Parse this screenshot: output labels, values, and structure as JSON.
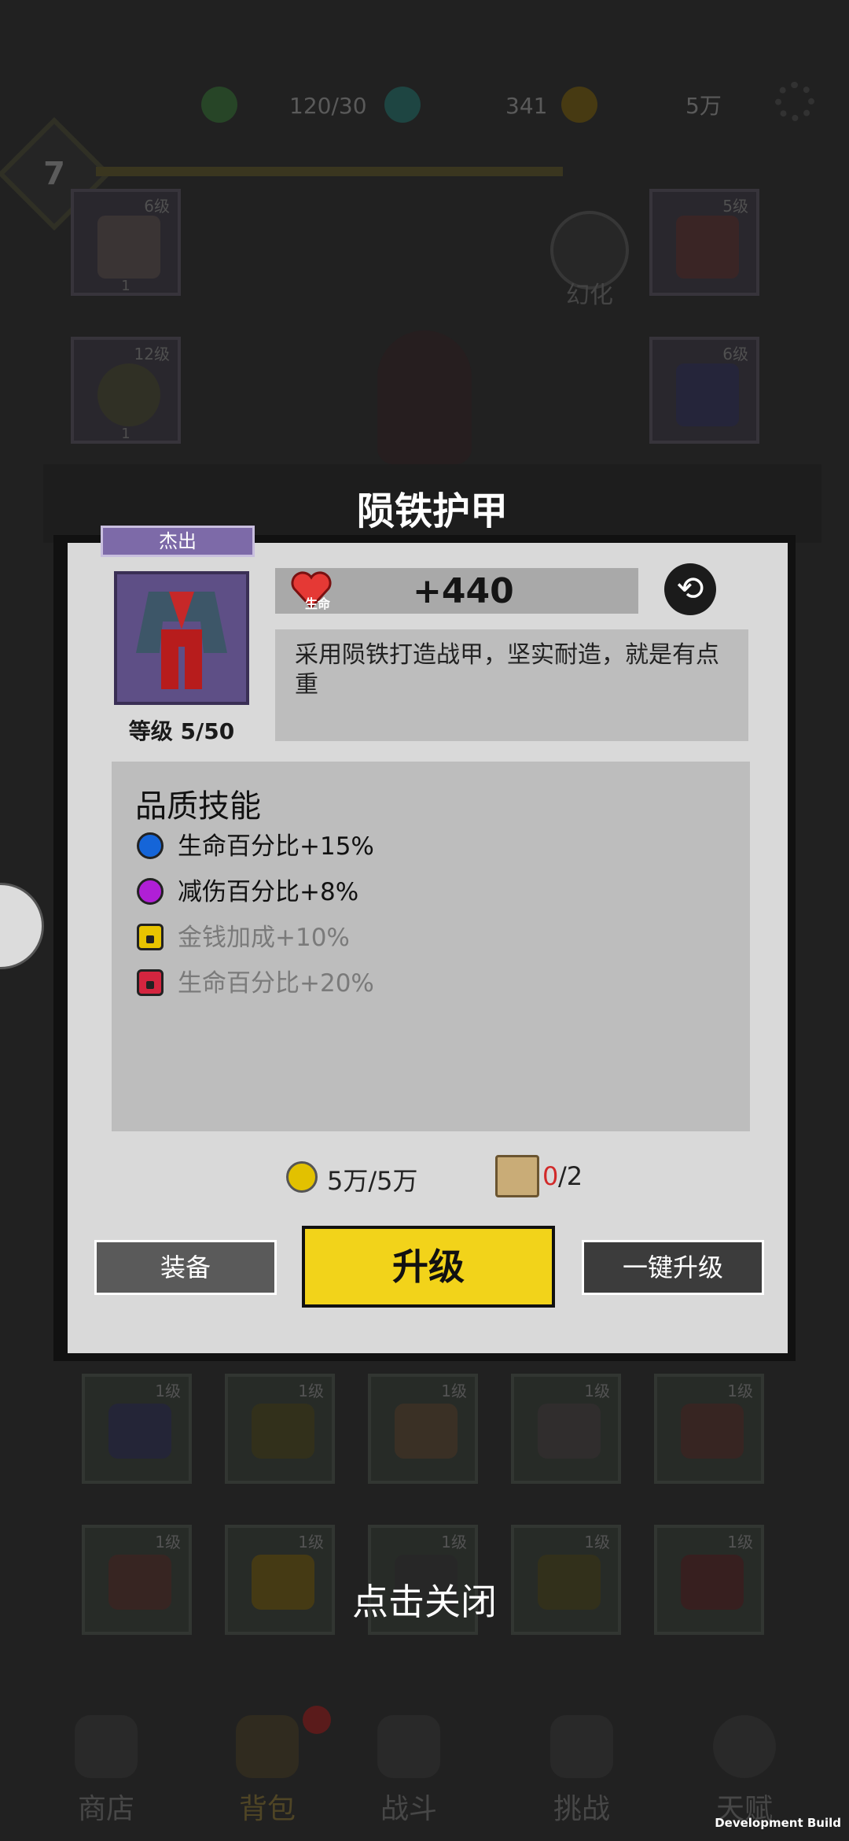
{
  "resources": {
    "energy": "120/30",
    "gems": "341",
    "gold": "5万"
  },
  "player_level": "7",
  "top_slots": [
    {
      "level": "6级",
      "count": "1"
    },
    {
      "level": "5级"
    },
    {
      "level": "12级",
      "count": "1"
    },
    {
      "level": "6级"
    }
  ],
  "transform_label": "幻化",
  "dialog": {
    "title": "陨铁护甲",
    "quality": "杰出",
    "item_level": "等级 5/50",
    "stat_label": "生命",
    "stat_value": "+440",
    "description": "采用陨铁打造战甲，坚实耐造，就是有点重",
    "skills_title": "品质技能",
    "skills": [
      {
        "text": "生命百分比+15%",
        "color": "#1565d8",
        "unlocked": true
      },
      {
        "text": "减伤百分比+8%",
        "color": "#b01fd6",
        "unlocked": true
      },
      {
        "text": "金钱加成+10%",
        "color": "#e8c400",
        "unlocked": false
      },
      {
        "text": "生命百分比+20%",
        "color": "#d4253f",
        "unlocked": false
      }
    ],
    "cost_gold": "5万/5万",
    "cost_scroll_have": "0",
    "cost_scroll_need": "/2",
    "equip_label": "装备",
    "upgrade_label": "升级",
    "auto_upgrade_label": "一键升级"
  },
  "inventory_levels": [
    "1级",
    "1级",
    "1级",
    "1级",
    "1级",
    "1级",
    "1级",
    "1级",
    "1级",
    "1级"
  ],
  "close_hint": "点击关闭",
  "nav": [
    "商店",
    "背包",
    "战斗",
    "挑战",
    "天赋"
  ],
  "dev_build": "Development Build",
  "colors": {
    "upgrade_button": "#f2d31a",
    "quality_tag": "#7d6aa8",
    "scroll_have": "#d12a2a"
  }
}
